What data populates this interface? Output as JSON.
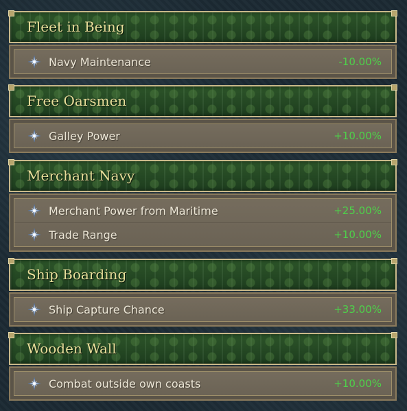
{
  "panels": [
    {
      "title": "Fleet in Being",
      "modifiers": [
        {
          "icon": "star-compass-icon",
          "label": "Navy Maintenance",
          "value": "-10.00%"
        }
      ]
    },
    {
      "title": "Free Oarsmen",
      "modifiers": [
        {
          "icon": "star-compass-icon",
          "label": "Galley Power",
          "value": "+10.00%"
        }
      ]
    },
    {
      "title": "Merchant Navy",
      "modifiers": [
        {
          "icon": "star-compass-icon",
          "label": "Merchant Power from Maritime",
          "value": "+25.00%"
        },
        {
          "icon": "star-compass-icon",
          "label": "Trade Range",
          "value": "+10.00%"
        }
      ]
    },
    {
      "title": "Ship Boarding",
      "modifiers": [
        {
          "icon": "star-compass-icon",
          "label": "Ship Capture Chance",
          "value": "+33.00%"
        }
      ]
    },
    {
      "title": "Wooden Wall",
      "modifiers": [
        {
          "icon": "star-compass-icon",
          "label": "Combat outside own coasts",
          "value": "+10.00%"
        }
      ]
    }
  ],
  "colors": {
    "title_text": "#e8de9a",
    "value_positive": "#4ed14a",
    "header_green": "#244a22",
    "row_brown": "#756c5d"
  }
}
